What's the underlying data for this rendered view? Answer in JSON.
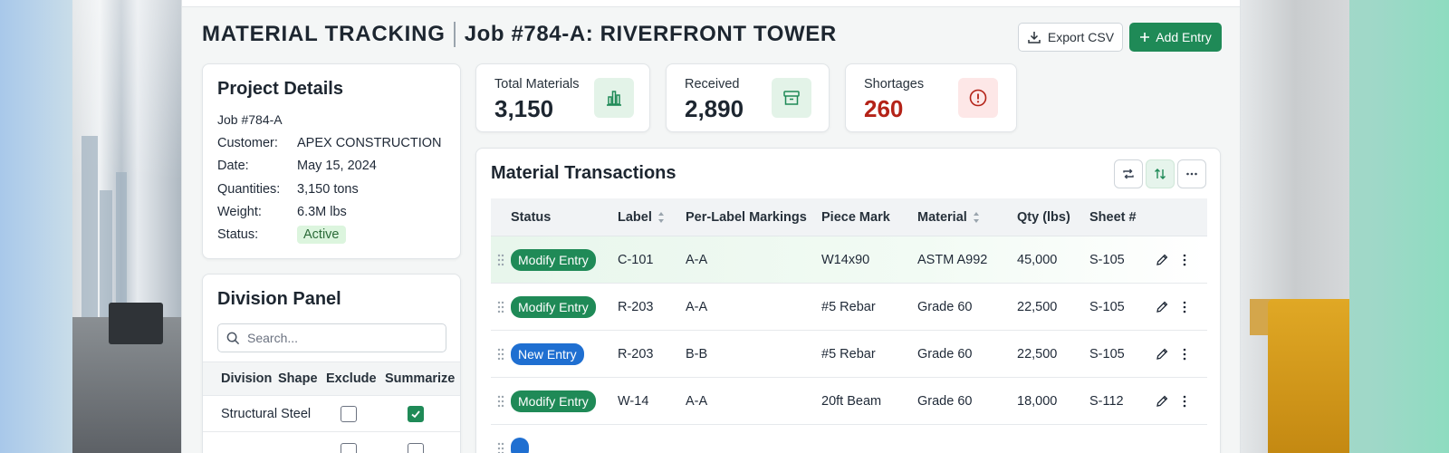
{
  "header": {
    "title": "MATERIAL TRACKING",
    "job": "Job #784-A: RIVERFRONT TOWER",
    "export_label": "Export CSV",
    "add_label": "Add Entry"
  },
  "project": {
    "title": "Project Details",
    "job": "Job #784-A",
    "rows": [
      {
        "key": "Customer:",
        "value": "APEX CONSTRUCTION"
      },
      {
        "key": "Date:",
        "value": "May 15, 2024"
      },
      {
        "key": "Quantities:",
        "value": "3,150 tons"
      },
      {
        "key": "Weight:",
        "value": "6.3M lbs"
      },
      {
        "key": "Status:",
        "value": "Active"
      }
    ]
  },
  "stats": [
    {
      "label": "Total Materials",
      "value": "3,150",
      "icon": "bar-chart-icon",
      "color": "#1f8a57"
    },
    {
      "label": "Received",
      "value": "2,890",
      "icon": "archive-box-icon",
      "color": "#1f8a57"
    },
    {
      "label": "Shortages",
      "value": "260",
      "icon": "alert-circle-icon",
      "color": "#b42318"
    }
  ],
  "division": {
    "title": "Division Panel",
    "search_placeholder": "Search...",
    "headers": [
      "Division",
      "Shape",
      "Exclude",
      "Summarize"
    ],
    "rows": [
      {
        "division": "Structural Steel",
        "exclude": false,
        "summarize": true
      }
    ]
  },
  "transactions": {
    "title": "Material Transactions",
    "headers": {
      "status": "Status",
      "label": "Label",
      "markings": "Per-Label Markings",
      "piece": "Piece Mark",
      "material": "Material",
      "qty": "Qty (lbs)",
      "sheet": "Sheet #"
    },
    "rows": [
      {
        "status": "Modify Entry",
        "kind": "modify",
        "label": "C-101",
        "markings": "A-A",
        "piece": "W14x90",
        "material": "ASTM A992",
        "qty": "45,000",
        "sheet": "S-105"
      },
      {
        "status": "Modify Entry",
        "kind": "modify",
        "label": "R-203",
        "markings": "A-A",
        "piece": "#5 Rebar",
        "material": "Grade 60",
        "qty": "22,500",
        "sheet": "S-105"
      },
      {
        "status": "New Entry",
        "kind": "new",
        "label": "R-203",
        "markings": "B-B",
        "piece": "#5 Rebar",
        "material": "Grade 60",
        "qty": "22,500",
        "sheet": "S-105"
      },
      {
        "status": "Modify Entry",
        "kind": "modify",
        "label": "W-14",
        "markings": "A-A",
        "piece": "20ft Beam",
        "material": "Grade 60",
        "qty": "18,000",
        "sheet": "S-112"
      }
    ]
  }
}
